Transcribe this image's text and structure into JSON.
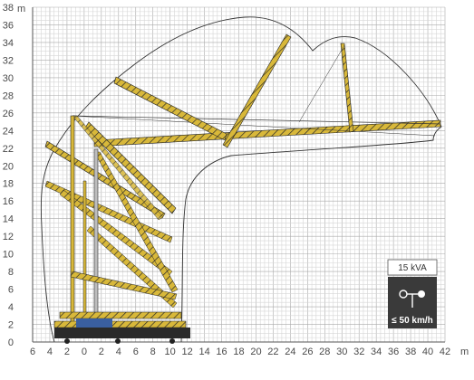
{
  "diagram": {
    "x_axis": {
      "ticks": [
        "6",
        "4",
        "2",
        "0",
        "2",
        "4",
        "6",
        "8",
        "10",
        "12",
        "14",
        "16",
        "18",
        "20",
        "22",
        "24",
        "26",
        "28",
        "30",
        "32",
        "34",
        "36",
        "38",
        "40",
        "42"
      ],
      "unit": "m"
    },
    "y_axis": {
      "ticks": [
        "0",
        "2",
        "4",
        "6",
        "8",
        "10",
        "12",
        "14",
        "16",
        "18",
        "20",
        "22",
        "24",
        "26",
        "28",
        "30",
        "32",
        "34",
        "36",
        "38"
      ],
      "unit": "m"
    },
    "badge": {
      "power": "15 kVA",
      "wind_limit": "≤ 50 km/h",
      "icon": "wind-anemometer-icon"
    },
    "colors": {
      "boom_yellow": "#d8b83a",
      "boom_dark": "#1e1e1e",
      "grid": "#bdbdbd",
      "badge_bg": "#3a3a3a"
    }
  }
}
